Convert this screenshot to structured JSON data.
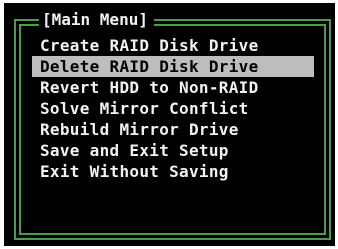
{
  "menu": {
    "title": "[Main Menu]",
    "selected_index": 1,
    "items": [
      {
        "label": "Create RAID Disk Drive"
      },
      {
        "label": "Delete RAID Disk Drive"
      },
      {
        "label": "Revert HDD to Non-RAID"
      },
      {
        "label": "Solve Mirror Conflict"
      },
      {
        "label": "Rebuild Mirror Drive"
      },
      {
        "label": "Save and Exit Setup"
      },
      {
        "label": "Exit Without Saving"
      }
    ]
  },
  "colors": {
    "background": "#000000",
    "border": "#4f9a4f",
    "text": "#f2f2f2",
    "highlight_bg": "#bdbdbd",
    "highlight_text": "#000000"
  }
}
